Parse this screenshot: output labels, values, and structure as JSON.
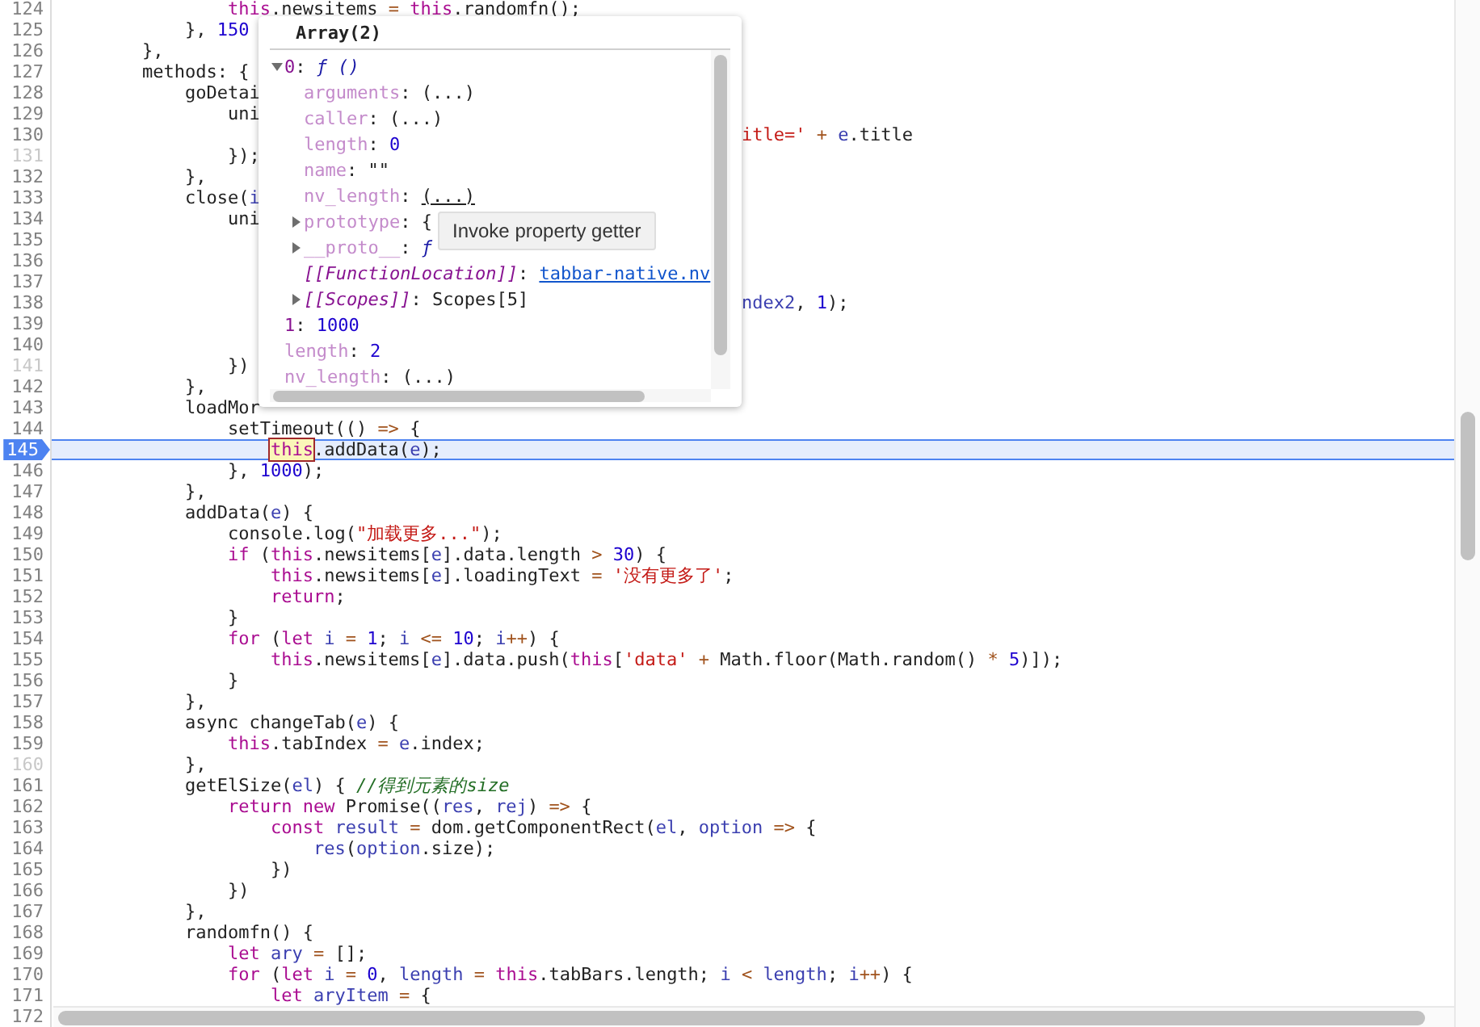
{
  "editor": {
    "lines": [
      {
        "number": "124",
        "executable": true,
        "paused": false,
        "code": [
          {
            "kind": "kw",
            "text": "                this"
          },
          {
            "kind": "plain",
            "text": ".newsitems"
          },
          {
            "kind": "op",
            "text": " = "
          },
          {
            "kind": "kw",
            "text": "this"
          },
          {
            "kind": "plain",
            "text": ".randomfn();"
          }
        ]
      },
      {
        "number": "125",
        "executable": true,
        "paused": false,
        "code": [
          {
            "kind": "plain",
            "text": "            }, "
          },
          {
            "kind": "num",
            "text": "150"
          }
        ]
      },
      {
        "number": "126",
        "executable": true,
        "paused": false,
        "code": [
          {
            "kind": "plain",
            "text": "        },"
          }
        ]
      },
      {
        "number": "127",
        "executable": true,
        "paused": false,
        "code": [
          {
            "kind": "plain",
            "text": "        methods: {"
          }
        ]
      },
      {
        "number": "128",
        "executable": true,
        "paused": false,
        "code": [
          {
            "kind": "plain",
            "text": "            goDetai"
          }
        ]
      },
      {
        "number": "129",
        "executable": true,
        "paused": false,
        "code": [
          {
            "kind": "plain",
            "text": "                uni"
          }
        ]
      },
      {
        "number": "130",
        "executable": true,
        "paused": false,
        "tail": [
          {
            "kind": "str",
            "text": "itle='"
          },
          {
            "kind": "op",
            "text": " + "
          },
          {
            "kind": "var",
            "text": "e"
          },
          {
            "kind": "plain",
            "text": ".title"
          }
        ]
      },
      {
        "number": "131",
        "executable": false,
        "paused": false,
        "code": [
          {
            "kind": "plain",
            "text": "                });"
          }
        ]
      },
      {
        "number": "132",
        "executable": true,
        "paused": false,
        "code": [
          {
            "kind": "plain",
            "text": "            },"
          }
        ]
      },
      {
        "number": "133",
        "executable": true,
        "paused": false,
        "code": [
          {
            "kind": "plain",
            "text": "            close("
          },
          {
            "kind": "var",
            "text": "i"
          }
        ]
      },
      {
        "number": "134",
        "executable": true,
        "paused": false,
        "code": [
          {
            "kind": "plain",
            "text": "                uni"
          }
        ]
      },
      {
        "number": "135",
        "executable": true,
        "paused": false
      },
      {
        "number": "136",
        "executable": true,
        "paused": false
      },
      {
        "number": "137",
        "executable": true,
        "paused": false
      },
      {
        "number": "138",
        "executable": true,
        "paused": false,
        "tail": [
          {
            "kind": "var",
            "text": "ndex2"
          },
          {
            "kind": "plain",
            "text": ", "
          },
          {
            "kind": "num",
            "text": "1"
          },
          {
            "kind": "plain",
            "text": ");"
          }
        ]
      },
      {
        "number": "139",
        "executable": true,
        "paused": false
      },
      {
        "number": "140",
        "executable": true,
        "paused": false
      },
      {
        "number": "141",
        "executable": false,
        "paused": false,
        "code": [
          {
            "kind": "plain",
            "text": "                })"
          }
        ]
      },
      {
        "number": "142",
        "executable": true,
        "paused": false,
        "code": [
          {
            "kind": "plain",
            "text": "            },"
          }
        ]
      },
      {
        "number": "143",
        "executable": true,
        "paused": false,
        "code": [
          {
            "kind": "plain",
            "text": "            loadMor"
          }
        ]
      },
      {
        "number": "144",
        "executable": true,
        "paused": false,
        "code": [
          {
            "kind": "plain",
            "text": "                setTimeout(() "
          },
          {
            "kind": "op",
            "text": "=>"
          },
          {
            "kind": "plain",
            "text": " {"
          }
        ]
      },
      {
        "number": "145",
        "executable": true,
        "paused": true,
        "code": [
          {
            "kind": "hover",
            "text": "                    this"
          },
          {
            "kind": "plain",
            "text": ".addData("
          },
          {
            "kind": "var",
            "text": "e"
          },
          {
            "kind": "plain",
            "text": ");"
          }
        ]
      },
      {
        "number": "146",
        "executable": true,
        "paused": false,
        "code": [
          {
            "kind": "plain",
            "text": "                }, "
          },
          {
            "kind": "num",
            "text": "1000"
          },
          {
            "kind": "plain",
            "text": ");"
          }
        ]
      },
      {
        "number": "147",
        "executable": true,
        "paused": false,
        "code": [
          {
            "kind": "plain",
            "text": "            },"
          }
        ]
      },
      {
        "number": "148",
        "executable": true,
        "paused": false,
        "code": [
          {
            "kind": "plain",
            "text": "            addData("
          },
          {
            "kind": "var",
            "text": "e"
          },
          {
            "kind": "plain",
            "text": ") {"
          }
        ]
      },
      {
        "number": "149",
        "executable": true,
        "paused": false,
        "code": [
          {
            "kind": "plain",
            "text": "                console.log("
          },
          {
            "kind": "str",
            "text": "\"加载更多...\""
          },
          {
            "kind": "plain",
            "text": ");"
          }
        ]
      },
      {
        "number": "150",
        "executable": true,
        "paused": false,
        "code": [
          {
            "kind": "kw",
            "text": "                if"
          },
          {
            "kind": "plain",
            "text": " ("
          },
          {
            "kind": "kw",
            "text": "this"
          },
          {
            "kind": "plain",
            "text": ".newsitems["
          },
          {
            "kind": "var",
            "text": "e"
          },
          {
            "kind": "plain",
            "text": "].data.length"
          },
          {
            "kind": "op",
            "text": " > "
          },
          {
            "kind": "num",
            "text": "30"
          },
          {
            "kind": "plain",
            "text": ") {"
          }
        ]
      },
      {
        "number": "151",
        "executable": true,
        "paused": false,
        "code": [
          {
            "kind": "kw",
            "text": "                    this"
          },
          {
            "kind": "plain",
            "text": ".newsitems["
          },
          {
            "kind": "var",
            "text": "e"
          },
          {
            "kind": "plain",
            "text": "].loadingText"
          },
          {
            "kind": "op",
            "text": " = "
          },
          {
            "kind": "str",
            "text": "'没有更多了'"
          },
          {
            "kind": "plain",
            "text": ";"
          }
        ]
      },
      {
        "number": "152",
        "executable": true,
        "paused": false,
        "code": [
          {
            "kind": "kw",
            "text": "                    return"
          },
          {
            "kind": "plain",
            "text": ";"
          }
        ]
      },
      {
        "number": "153",
        "executable": true,
        "paused": false,
        "code": [
          {
            "kind": "plain",
            "text": "                }"
          }
        ]
      },
      {
        "number": "154",
        "executable": true,
        "paused": false,
        "code": [
          {
            "kind": "kw",
            "text": "                for"
          },
          {
            "kind": "plain",
            "text": " ("
          },
          {
            "kind": "kw",
            "text": "let "
          },
          {
            "kind": "var",
            "text": "i"
          },
          {
            "kind": "op",
            "text": " = "
          },
          {
            "kind": "num",
            "text": "1"
          },
          {
            "kind": "plain",
            "text": "; "
          },
          {
            "kind": "var",
            "text": "i"
          },
          {
            "kind": "op",
            "text": " <= "
          },
          {
            "kind": "num",
            "text": "10"
          },
          {
            "kind": "plain",
            "text": "; "
          },
          {
            "kind": "var",
            "text": "i"
          },
          {
            "kind": "op",
            "text": "++"
          },
          {
            "kind": "plain",
            "text": ") {"
          }
        ]
      },
      {
        "number": "155",
        "executable": true,
        "paused": false,
        "code": [
          {
            "kind": "kw",
            "text": "                    this"
          },
          {
            "kind": "plain",
            "text": ".newsitems["
          },
          {
            "kind": "var",
            "text": "e"
          },
          {
            "kind": "plain",
            "text": "].data.push("
          },
          {
            "kind": "kw",
            "text": "this"
          },
          {
            "kind": "plain",
            "text": "["
          },
          {
            "kind": "str",
            "text": "'data'"
          },
          {
            "kind": "op",
            "text": " + "
          },
          {
            "kind": "plain",
            "text": "Math.floor(Math.random()"
          },
          {
            "kind": "op",
            "text": " * "
          },
          {
            "kind": "num",
            "text": "5"
          },
          {
            "kind": "plain",
            "text": ")]);"
          }
        ]
      },
      {
        "number": "156",
        "executable": true,
        "paused": false,
        "code": [
          {
            "kind": "plain",
            "text": "                }"
          }
        ]
      },
      {
        "number": "157",
        "executable": true,
        "paused": false,
        "code": [
          {
            "kind": "plain",
            "text": "            },"
          }
        ]
      },
      {
        "number": "158",
        "executable": true,
        "paused": false,
        "code": [
          {
            "kind": "plain",
            "text": "            async changeTab("
          },
          {
            "kind": "var",
            "text": "e"
          },
          {
            "kind": "plain",
            "text": ") {"
          }
        ]
      },
      {
        "number": "159",
        "executable": true,
        "paused": false,
        "code": [
          {
            "kind": "kw",
            "text": "                this"
          },
          {
            "kind": "plain",
            "text": ".tabIndex"
          },
          {
            "kind": "op",
            "text": " = "
          },
          {
            "kind": "var",
            "text": "e"
          },
          {
            "kind": "plain",
            "text": ".index;"
          }
        ]
      },
      {
        "number": "160",
        "executable": false,
        "paused": false,
        "code": [
          {
            "kind": "plain",
            "text": "            },"
          }
        ]
      },
      {
        "number": "161",
        "executable": true,
        "paused": false,
        "code": [
          {
            "kind": "plain",
            "text": "            getElSize("
          },
          {
            "kind": "var",
            "text": "el"
          },
          {
            "kind": "plain",
            "text": ") { "
          },
          {
            "kind": "com",
            "text": "//得到元素的size"
          }
        ]
      },
      {
        "number": "162",
        "executable": true,
        "paused": false,
        "code": [
          {
            "kind": "kw",
            "text": "                return new "
          },
          {
            "kind": "plain",
            "text": "Promise(("
          },
          {
            "kind": "var",
            "text": "res"
          },
          {
            "kind": "plain",
            "text": ", "
          },
          {
            "kind": "var",
            "text": "rej"
          },
          {
            "kind": "plain",
            "text": ") "
          },
          {
            "kind": "op",
            "text": "=>"
          },
          {
            "kind": "plain",
            "text": " {"
          }
        ]
      },
      {
        "number": "163",
        "executable": true,
        "paused": false,
        "code": [
          {
            "kind": "kw",
            "text": "                    const "
          },
          {
            "kind": "var",
            "text": "result"
          },
          {
            "kind": "op",
            "text": " = "
          },
          {
            "kind": "plain",
            "text": "dom.getComponentRect("
          },
          {
            "kind": "var",
            "text": "el"
          },
          {
            "kind": "plain",
            "text": ", "
          },
          {
            "kind": "var",
            "text": "option"
          },
          {
            "kind": "op",
            "text": " => "
          },
          {
            "kind": "plain",
            "text": "{"
          }
        ]
      },
      {
        "number": "164",
        "executable": true,
        "paused": false,
        "code": [
          {
            "kind": "var",
            "text": "                        res"
          },
          {
            "kind": "plain",
            "text": "("
          },
          {
            "kind": "var",
            "text": "option"
          },
          {
            "kind": "plain",
            "text": ".size);"
          }
        ]
      },
      {
        "number": "165",
        "executable": true,
        "paused": false,
        "code": [
          {
            "kind": "plain",
            "text": "                    })"
          }
        ]
      },
      {
        "number": "166",
        "executable": true,
        "paused": false,
        "code": [
          {
            "kind": "plain",
            "text": "                })"
          }
        ]
      },
      {
        "number": "167",
        "executable": true,
        "paused": false,
        "code": [
          {
            "kind": "plain",
            "text": "            },"
          }
        ]
      },
      {
        "number": "168",
        "executable": true,
        "paused": false,
        "code": [
          {
            "kind": "plain",
            "text": "            randomfn() {"
          }
        ]
      },
      {
        "number": "169",
        "executable": true,
        "paused": false,
        "code": [
          {
            "kind": "kw",
            "text": "                let "
          },
          {
            "kind": "var",
            "text": "ary"
          },
          {
            "kind": "op",
            "text": " = "
          },
          {
            "kind": "plain",
            "text": "[];"
          }
        ]
      },
      {
        "number": "170",
        "executable": true,
        "paused": false,
        "code": [
          {
            "kind": "kw",
            "text": "                for"
          },
          {
            "kind": "plain",
            "text": " ("
          },
          {
            "kind": "kw",
            "text": "let "
          },
          {
            "kind": "var",
            "text": "i"
          },
          {
            "kind": "op",
            "text": " = "
          },
          {
            "kind": "num",
            "text": "0"
          },
          {
            "kind": "plain",
            "text": ", "
          },
          {
            "kind": "var",
            "text": "length"
          },
          {
            "kind": "op",
            "text": " = "
          },
          {
            "kind": "kw",
            "text": "this"
          },
          {
            "kind": "plain",
            "text": ".tabBars.length; "
          },
          {
            "kind": "var",
            "text": "i"
          },
          {
            "kind": "op",
            "text": " < "
          },
          {
            "kind": "var",
            "text": "length"
          },
          {
            "kind": "plain",
            "text": "; "
          },
          {
            "kind": "var",
            "text": "i"
          },
          {
            "kind": "op",
            "text": "++"
          },
          {
            "kind": "plain",
            "text": ") {"
          }
        ]
      },
      {
        "number": "171",
        "executable": true,
        "paused": false,
        "code": [
          {
            "kind": "kw",
            "text": "                    let "
          },
          {
            "kind": "var",
            "text": "aryItem"
          },
          {
            "kind": "op",
            "text": " = "
          },
          {
            "kind": "plain",
            "text": "{"
          }
        ]
      },
      {
        "number": "172",
        "executable": true,
        "paused": false
      }
    ]
  },
  "popover": {
    "title": "Array(2)",
    "tree": [
      {
        "key": {
          "text": "0",
          "kind": "own"
        },
        "separator": ":",
        "value": {
          "text": "ƒ ()",
          "kind": "func"
        },
        "hovered": false,
        "expanded": true,
        "children": [
          {
            "key": {
              "text": "arguments",
              "kind": "dim"
            },
            "separator": ":",
            "value": {
              "text": "(...)",
              "kind": "getter"
            },
            "hovered": false
          },
          {
            "key": {
              "text": "caller",
              "kind": "dim"
            },
            "separator": ":",
            "value": {
              "text": "(...)",
              "kind": "getter"
            },
            "hovered": false
          },
          {
            "key": {
              "text": "length",
              "kind": "dim"
            },
            "separator": ":",
            "value": {
              "text": "0",
              "kind": "number"
            },
            "hovered": false
          },
          {
            "key": {
              "text": "name",
              "kind": "dim"
            },
            "separator": ":",
            "value": {
              "text": "\"\"",
              "kind": "string"
            },
            "hovered": false
          },
          {
            "key": {
              "text": "nv_length",
              "kind": "dim"
            },
            "separator": ":",
            "value": {
              "text": "(...)",
              "kind": "getter"
            },
            "hovered": true
          },
          {
            "key": {
              "text": "prototype",
              "kind": "dim"
            },
            "separator": ":",
            "value": {
              "text": "{",
              "kind": "getter"
            },
            "hovered": false,
            "expanded": false
          },
          {
            "key": {
              "text": "__proto__",
              "kind": "dim"
            },
            "separator": ":",
            "value": {
              "text": "ƒ",
              "kind": "func"
            },
            "hovered": false,
            "expanded": false
          },
          {
            "key": {
              "text": "[[FunctionLocation]]",
              "kind": "internal"
            },
            "separator": ":",
            "value": {
              "text": "tabbar-native.nv",
              "kind": "link"
            },
            "hovered": false
          },
          {
            "key": {
              "text": "[[Scopes]]",
              "kind": "internal"
            },
            "separator": ":",
            "value": {
              "text": "Scopes[5]",
              "kind": "getter"
            },
            "hovered": false,
            "expanded": false
          }
        ]
      },
      {
        "key": {
          "text": "1",
          "kind": "own"
        },
        "separator": ":",
        "value": {
          "text": "1000",
          "kind": "number"
        },
        "hovered": false
      },
      {
        "key": {
          "text": "length",
          "kind": "dim"
        },
        "separator": ":",
        "value": {
          "text": "2",
          "kind": "number"
        },
        "hovered": false
      },
      {
        "key": {
          "text": "nv_length",
          "kind": "dim"
        },
        "separator": ":",
        "value": {
          "text": "(...)",
          "kind": "getter"
        },
        "hovered": false
      }
    ]
  },
  "tooltip": {
    "text": "Invoke property getter"
  }
}
